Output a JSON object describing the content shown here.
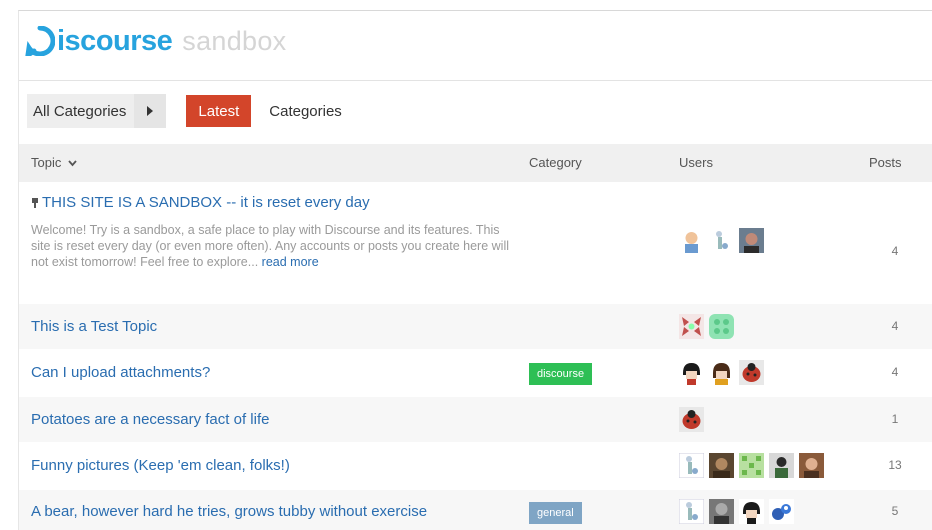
{
  "header": {
    "logo_word": "iscourse",
    "logo_sub": "sandbox"
  },
  "nav": {
    "category_dropdown": "All Categories",
    "latest_tab": "Latest",
    "categories_tab": "Categories"
  },
  "table": {
    "headers": {
      "topic": "Topic",
      "category": "Category",
      "users": "Users",
      "posts": "Posts"
    },
    "rows": [
      {
        "title": "THIS SITE IS A SANDBOX -- it is reset every day",
        "excerpt": "Welcome! Try is a sandbox, a safe place to play with Discourse and its features. This site is reset every day (or even more often). Any accounts or posts you create here will not exist tomorrow! Feel free to explore...",
        "read_more": "read more",
        "category": "",
        "posts": "4",
        "avatars": [
          "face-peach",
          "pale-figure",
          "face-photo"
        ]
      },
      {
        "title": "This is a Test Topic",
        "category": "",
        "posts": "4",
        "avatars": [
          "identicon-red",
          "identicon-green"
        ]
      },
      {
        "title": "Can I upload attachments?",
        "category": "discourse",
        "category_color": "#2ebf55",
        "posts": "4",
        "avatars": [
          "bowl-cut",
          "bowl-cut-brown",
          "ladybug"
        ]
      },
      {
        "title": "Potatoes are a necessary fact of life",
        "category": "",
        "posts": "1",
        "avatars": [
          "ladybug"
        ]
      },
      {
        "title": "Funny pictures (Keep 'em clean, folks!)",
        "category": "",
        "posts": "13",
        "avatars": [
          "pale-figure",
          "photo-dark",
          "identicon-green",
          "photo-person",
          "photo-brown"
        ]
      },
      {
        "title": "A bear, however hard he tries, grows tubby without exercise",
        "category": "general",
        "category_color": "#7fa5c5",
        "posts": "5",
        "avatars": [
          "pale-figure",
          "photo-gray",
          "bowl-cut",
          "mascot-blue"
        ]
      }
    ]
  }
}
